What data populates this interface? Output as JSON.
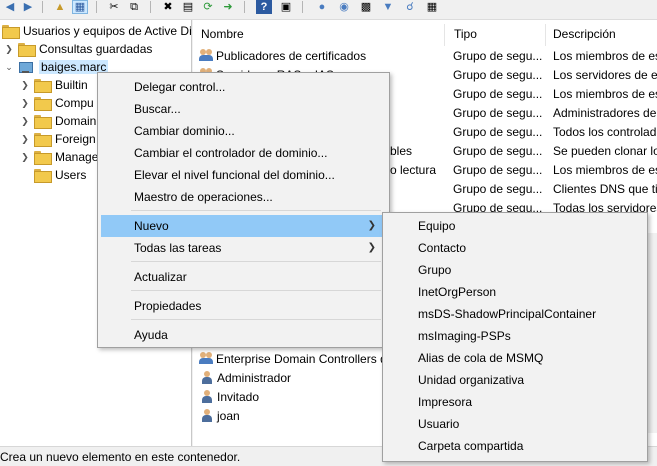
{
  "toolbar": {
    "icons": [
      "back-arrow-icon",
      "forward-arrow-icon",
      "up-folder-icon",
      "show-tree-icon",
      "cut-icon",
      "copy-icon",
      "delete-icon",
      "properties-icon",
      "refresh-icon",
      "export-icon",
      "help-icon",
      "console-icon",
      "users-icon",
      "group-icon",
      "filter-icon",
      "find-icon",
      "add-to-group-icon"
    ]
  },
  "tree": {
    "root": "Usuarios y equipos de Active Dir",
    "saved_queries": "Consultas guardadas",
    "domain": "baiges.marc",
    "children": [
      "Builtin",
      "Compu",
      "Domain",
      "Foreign",
      "Manage",
      "Users"
    ]
  },
  "list": {
    "columns": {
      "name": "Nombre",
      "type": "Tipo",
      "description": "Descripción"
    },
    "rows": [
      {
        "name": "Publicadores de certificados",
        "type": "Grupo de segu...",
        "description": "Los miembros de es"
      },
      {
        "name": "Servidores RAS e IAS",
        "type": "Grupo de segu...",
        "description": "Los servidores de e"
      },
      {
        "name": "",
        "type": "Grupo de segu...",
        "description": "Los miembros de es"
      },
      {
        "name": "",
        "type": "Grupo de segu...",
        "description": "Administradores de"
      },
      {
        "name": "",
        "type": "Grupo de segu...",
        "description": "Todos los controlad"
      },
      {
        "name": "bles",
        "type": "Grupo de segu...",
        "description": "Se pueden clonar lo"
      },
      {
        "name": "o lectura",
        "type": "Grupo de segu...",
        "description": "Los miembros de es"
      },
      {
        "name": "",
        "type": "Grupo de segu...",
        "description": "Clientes DNS que tie"
      },
      {
        "name": "",
        "type": "Grupo de segu...",
        "description": "Todas los servidores"
      }
    ],
    "bottom_rows": [
      {
        "name": "Enterprise Domain Controllers d",
        "icon": "group-icon"
      },
      {
        "name": "Administrador",
        "icon": "user-icon"
      },
      {
        "name": "Invitado",
        "icon": "user-icon"
      },
      {
        "name": "joan",
        "icon": "user-icon"
      }
    ]
  },
  "context_menu": {
    "items": [
      "Delegar control...",
      "Buscar...",
      "Cambiar dominio...",
      "Cambiar el controlador de dominio...",
      "Elevar el nivel funcional del dominio...",
      "Maestro de operaciones..."
    ],
    "new": "Nuevo",
    "all_tasks": "Todas las tareas",
    "refresh": "Actualizar",
    "properties": "Propiedades",
    "help": "Ayuda"
  },
  "submenu": {
    "items": [
      "Equipo",
      "Contacto",
      "Grupo",
      "InetOrgPerson",
      "msDS-ShadowPrincipalContainer",
      "msImaging-PSPs",
      "Alias de cola de MSMQ",
      "Unidad organizativa",
      "Impresora",
      "Usuario",
      "Carpeta compartida"
    ]
  },
  "status_bar": "Crea un nuevo elemento en este contenedor.",
  "colors": {
    "highlight": "#91c9f7",
    "selection": "#cce8ff",
    "menu_bg": "#f2f2f2"
  }
}
